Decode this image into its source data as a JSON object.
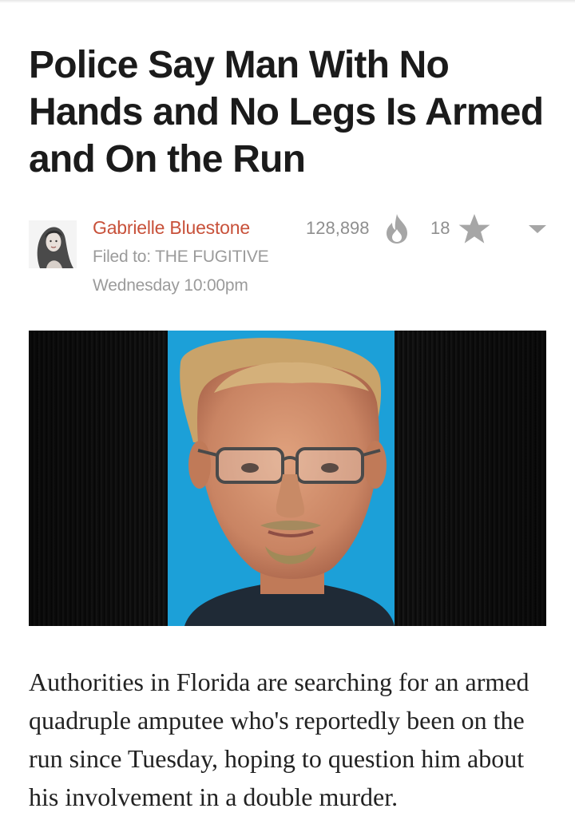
{
  "article": {
    "headline": "Police Say Man With No Hands and No Legs Is Armed and On the Run",
    "author": "Gabrielle Bluestone",
    "filed_to": "Filed to: THE FUGITIVE",
    "timestamp": "Wednesday 10:00pm",
    "views": "128,898",
    "stars": "18",
    "body": "Authorities in Florida are searching for an armed quadruple amputee who's reportedly been on the run since Tuesday, hoping to question him about his involvement in a double murder."
  },
  "icons": {
    "views": "flame-icon",
    "stars": "star-icon",
    "menu": "chevron-down-icon"
  },
  "colors": {
    "author": "#c8513a",
    "meta_text": "#9b9b9b",
    "icon_gray": "#a6a6a6",
    "photo_backdrop": "#1ca0d8"
  }
}
